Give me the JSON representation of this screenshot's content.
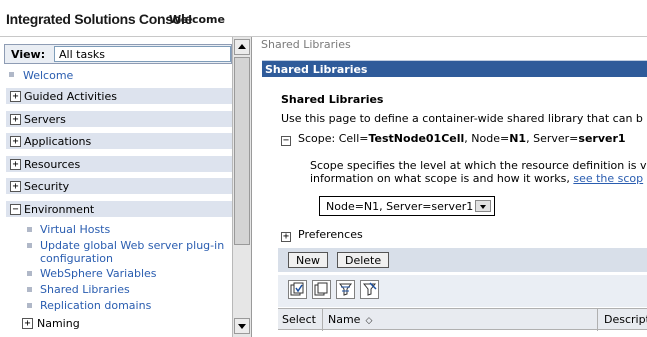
{
  "header": {
    "title": "Integrated Solutions Console",
    "welcome": "Welcome"
  },
  "nav": {
    "view_label": "View:",
    "view_value": "All tasks",
    "welcome": "Welcome",
    "groups": [
      {
        "label": "Guided Activities",
        "state": "+"
      },
      {
        "label": "Servers",
        "state": "+"
      },
      {
        "label": "Applications",
        "state": "+"
      },
      {
        "label": "Resources",
        "state": "+"
      },
      {
        "label": "Security",
        "state": "+"
      },
      {
        "label": "Environment",
        "state": "−"
      }
    ],
    "environment_items": [
      "Virtual Hosts",
      "Update global Web server plug-in",
      "configuration",
      "WebSphere Variables",
      "Shared Libraries",
      "Replication domains"
    ],
    "naming": {
      "label": "Naming",
      "state": "+"
    }
  },
  "content": {
    "breadcrumb": "Shared Libraries",
    "bar_title": "Shared Libraries",
    "heading": "Shared Libraries",
    "description": "Use this page to define a container-wide shared library that can b",
    "scope": {
      "state": "−",
      "prefix": "Scope: Cell=",
      "cell": "TestNode01Cell",
      "node_prefix": ", Node=",
      "node": "N1",
      "server_prefix": ", Server=",
      "server": "server1"
    },
    "scope_help_line1": "Scope specifies the level at which the resource definition is v",
    "scope_help_line2": "information on what scope is and how it works, ",
    "scope_help_link": "see the scop",
    "scope_select": "Node=N1, Server=server1",
    "preferences": {
      "label": "Preferences",
      "state": "+"
    },
    "buttons": {
      "new": "New",
      "delete": "Delete"
    },
    "icons": [
      "select-all-icon",
      "deselect-all-icon",
      "show-filter-icon",
      "clear-filter-icon"
    ],
    "table_headers": {
      "select": "Select",
      "name": "Name",
      "description": "Descript"
    }
  }
}
